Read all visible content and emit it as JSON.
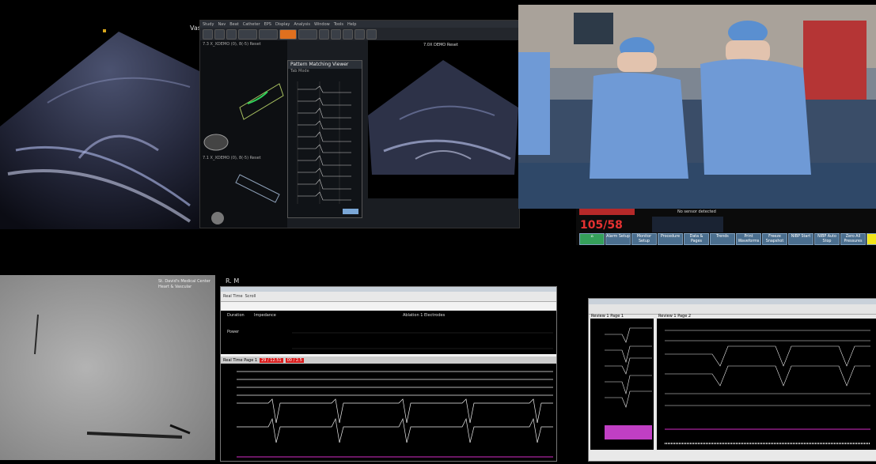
{
  "echo_left": {
    "label": "Vas"
  },
  "echo_workstation": {
    "menu": [
      "Study",
      "Nav",
      "Beat",
      "Catheter",
      "EPS",
      "Display",
      "Analysis",
      "Window",
      "Tools",
      "Help"
    ],
    "pattern_matching_viewer": {
      "title": "Pattern Matching Viewer",
      "tabs": [
        "Tab Mode"
      ]
    },
    "view_labels": [
      "7.3 X_XDEMO (0), 8(-5) Reset",
      "7.1 X_XDEMO (0), 8(-5) Reset"
    ],
    "right_view": {
      "header": "7.0X DEMO Reset"
    }
  },
  "video": {
    "desc_colors": {
      "gown": "#6f9ad6",
      "drape": "#2f4868"
    }
  },
  "monitor": {
    "bp": "105/58",
    "sensor": "No sensor detected",
    "buttons": [
      "Alarm Setup",
      "Monitor Setup",
      "Procedure",
      "Data & Pages",
      "Trends",
      "Print Waveforms",
      "Freeze Snapshot",
      "NIBP Start",
      "NIBP Auto Stop",
      "Zero All Pressures"
    ]
  },
  "fluoro": {
    "text": [
      "St. David's Medical Center",
      "Heart & Vascular"
    ]
  },
  "ep1": {
    "title": "R. M",
    "toolbar": {
      "mode": "Real Time",
      "scroll": "Scroll"
    },
    "energy": {
      "label": "Ablation 1 Electrodes",
      "duration_label": "Duration",
      "power_label": "Power",
      "impedance_label": "Impedance"
    },
    "page_label": "Real Time Page 1",
    "alerts": [
      "29 / 12.51",
      "00 / 2.5"
    ]
  },
  "ep2": {
    "pane1": "Review 1 Page 1",
    "pane2": "Review 1 Page 2"
  }
}
